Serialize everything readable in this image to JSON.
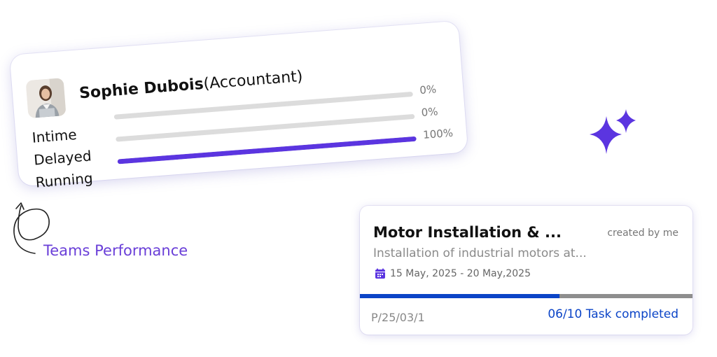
{
  "performance_card": {
    "name": "Sophie Dubois",
    "role": "(Accountant)",
    "metrics": [
      {
        "label": "Intime",
        "percent_text": "0%",
        "value": 0
      },
      {
        "label": "Delayed",
        "percent_text": "0%",
        "value": 0
      },
      {
        "label": "Running",
        "percent_text": "100%",
        "value": 100
      }
    ],
    "accent_color": "#5b35e0",
    "track_color": "#dcdcdc"
  },
  "caption": {
    "text": "Teams Performance",
    "color": "#6a3fd8"
  },
  "project_card": {
    "title": "Motor Installation & ...",
    "created_by": "created by me",
    "description": "Installation of industrial motors at...",
    "date_range": "15 May, 2025 - 20 May,2025",
    "code": "P/25/03/1",
    "task_status": "06/10 Task completed",
    "progress": 0.6,
    "progress_color": "#0b44c7",
    "remaining_color": "#8e8e8e",
    "calendar_icon": "calendar-icon"
  },
  "decor": {
    "sparkle_icon": "sparkle-icon",
    "sparkle_color": "#5b35e0",
    "doodle_icon": "loop-arrow-doodle-icon"
  }
}
